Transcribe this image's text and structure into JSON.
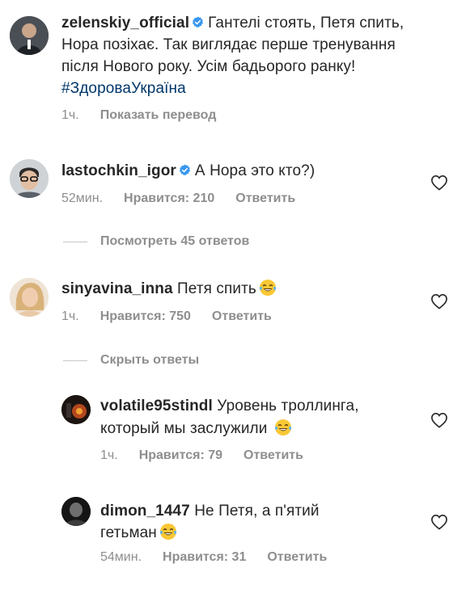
{
  "post": {
    "username": "zelenskiy_official",
    "lines": [
      "Гантелі стоять, Петя спить,",
      "Нора позіхає. Так виглядає перше тренування",
      "після Нового року. Усім бадьорого ранку!"
    ],
    "hashtag": "#ЗдороваУкраїна",
    "time": "1ч.",
    "translate": "Показать перевод"
  },
  "comments": [
    {
      "username": "lastochkin_igor",
      "text": "А Нора это кто?)",
      "time": "52мин.",
      "likes": "Нравится: 210",
      "reply": "Ответить",
      "thread_toggle": "Посмотреть 45 ответов"
    },
    {
      "username": "sinyavina_inna",
      "text": "Петя спить",
      "emoji": "face-with-tears-of-joy",
      "time": "1ч.",
      "likes": "Нравится: 750",
      "reply": "Ответить",
      "thread_toggle": "Скрыть ответы"
    }
  ],
  "replies": [
    {
      "username": "volatile95stindl",
      "text_line1": "Уровень троллинга,",
      "text_line2": "который мы заслужили",
      "emoji": "face-with-tears-of-joy",
      "time": "1ч.",
      "likes": "Нравится: 79",
      "reply": "Ответить"
    },
    {
      "username": "dimon_1447",
      "text_line1": "Не Петя, а п'ятий",
      "text_line2": "гетьман",
      "emoji": "face-with-tears-of-joy",
      "time": "54мин.",
      "likes": "Нравится: 31",
      "reply": "Ответить"
    }
  ],
  "colors": {
    "text": "#262626",
    "secondary": "#8e8e8e",
    "hashtag": "#00376b",
    "verified": "#3897f0"
  }
}
